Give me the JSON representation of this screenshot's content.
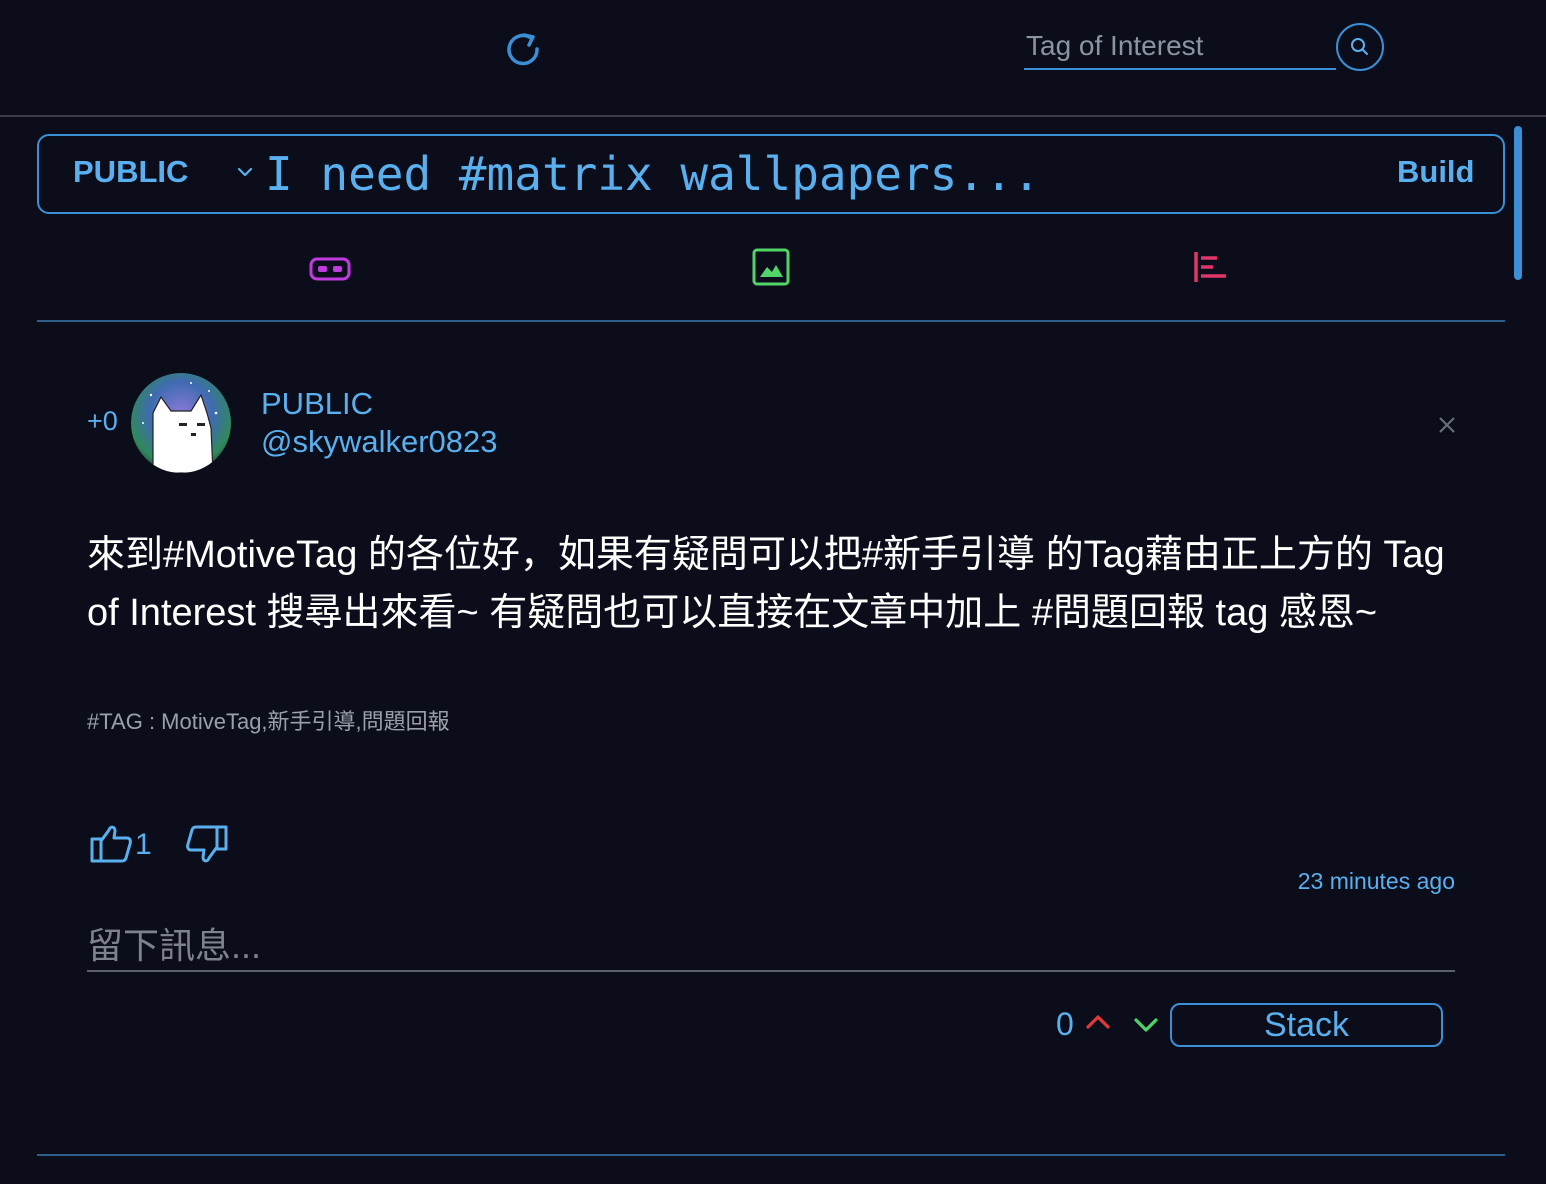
{
  "header": {
    "search_placeholder": "Tag of Interest",
    "refresh_icon": "refresh-icon",
    "search_icon": "search-icon"
  },
  "composer": {
    "privacy": "PUBLIC",
    "placeholder": "I need #matrix wallpapers...",
    "build_label": "Build",
    "tools": [
      "mask-icon",
      "image-icon",
      "poll-icon"
    ]
  },
  "post": {
    "score": "+0",
    "privacy": "PUBLIC",
    "username": "@skywalker0823",
    "body": "來到#MotiveTag 的各位好，如果有疑問可以把#新手引導 的Tag藉由正上方的 Tag of Interest 搜尋出來看~ 有疑問也可以直接在文章中加上 #問題回報 tag 感恩~",
    "tags": "#TAG : MotiveTag,新手引導,問題回報",
    "likes": "1",
    "timestamp": "23 minutes ago",
    "comment_placeholder": "留下訊息...",
    "stack_count": "0",
    "stack_label": "Stack"
  },
  "colors": {
    "background": "#0b0e1a",
    "accent": "#5ab0ef",
    "mask_icon": "#c23be0",
    "image_icon": "#52d468",
    "poll_icon": "#e0366a",
    "up_arrow": "#e03a3a",
    "down_arrow": "#4cd468"
  }
}
